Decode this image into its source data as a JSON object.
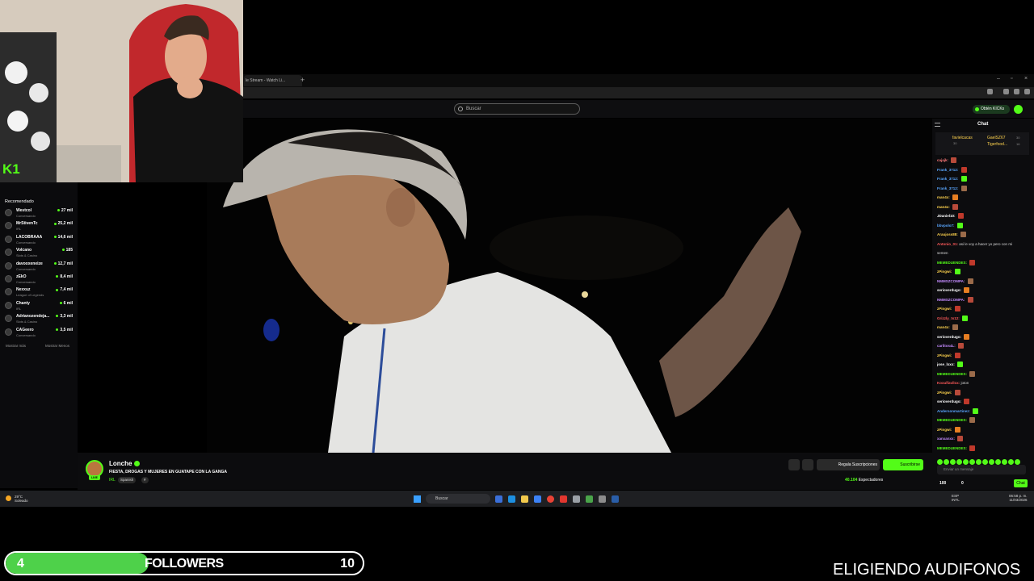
{
  "browser": {
    "tab_title": "le Stream - Watch Li...",
    "new_tab_label": "+",
    "window_controls": [
      "–",
      "▫",
      "×"
    ]
  },
  "header": {
    "search_placeholder": "Buscar",
    "kicks_label": "Obtén KICKs"
  },
  "sidebar": {
    "heading": "Recomendado",
    "items": [
      {
        "name": "Westcol",
        "category": "Conversando",
        "viewers": "27 mil"
      },
      {
        "name": "MrStivenTc",
        "category": "IRL",
        "viewers": "25,2 mil"
      },
      {
        "name": "LACOBRAAA",
        "category": "Conversando",
        "viewers": "14,6 mil"
      },
      {
        "name": "Volcano",
        "category": "Slots & Casino",
        "viewers": "185"
      },
      {
        "name": "davooxeneize",
        "category": "Conversando",
        "viewers": "12,7 mil"
      },
      {
        "name": "zEkO",
        "category": "Conversando",
        "viewers": "8,4 mil"
      },
      {
        "name": "Nexxuz",
        "category": "League of Legends",
        "viewers": "7,4 mil"
      },
      {
        "name": "Chanty",
        "category": "IRL",
        "viewers": "6 mil"
      },
      {
        "name": "Adrianozendeja...",
        "category": "Slots & Casino",
        "viewers": "3,3 mil"
      },
      {
        "name": "CAGeero",
        "category": "Conversando",
        "viewers": "3,5 mil"
      }
    ],
    "show_more": "Mostrar más",
    "show_less": "Mostrar Menos"
  },
  "stream": {
    "streamer": "Lonche",
    "live_badge": "LIVE",
    "title": "FIESTA, DROGAS Y MUJERES EN GUATAPE CON LA GANGA",
    "category": "IRL",
    "tags": [
      "Spanish",
      "#"
    ],
    "gift_label": "Regala Suscripciones",
    "subscribe_label": "Suscribirse",
    "viewer_count": "40.104",
    "viewer_label": "Espectadores"
  },
  "chat": {
    "title": "Chat",
    "pinned": [
      {
        "name": "favielcacas",
        "count": "30"
      },
      {
        "name": "GaelSZ67",
        "count": "30"
      },
      {
        "name": "Tigerfood...",
        "count": "16"
      }
    ],
    "messages": [
      {
        "user": "cajajk:",
        "msg": "",
        "color": "#ff7a7a"
      },
      {
        "user": "Frank_3712:",
        "msg": "",
        "color": "#5aa7ff"
      },
      {
        "user": "Frank_3712:",
        "msg": "",
        "color": "#5aa7ff"
      },
      {
        "user": "Frank_3712:",
        "msg": "",
        "color": "#5aa7ff"
      },
      {
        "user": "man4x:",
        "msg": "",
        "color": "#ffd34d"
      },
      {
        "user": "man4x:",
        "msg": "",
        "color": "#ffd34d"
      },
      {
        "user": "JDaniel10:",
        "msg": "",
        "color": "#ffffff"
      },
      {
        "user": "bbvpolo7:",
        "msg": "",
        "color": "#5aa7ff"
      },
      {
        "user": "Araujoss88:",
        "msg": "",
        "color": "#ffd34d"
      },
      {
        "user": "Antonio_01:",
        "msg": "asi le voy a hacer yo pero con mi",
        "color": "#ff5a5a"
      },
      {
        "user": "",
        "msg": "semen",
        "color": "#ddd"
      },
      {
        "user": "MEMEDUENDES:",
        "msg": "",
        "color": "#53fc18"
      },
      {
        "user": "zPingwi:",
        "msg": "",
        "color": "#ffd34d"
      },
      {
        "user": "NMMSZCOMPA:",
        "msg": "",
        "color": "#c48bff"
      },
      {
        "user": "serioverdugo:",
        "msg": "",
        "color": "#ffffff"
      },
      {
        "user": "NMMSZCOMPA:",
        "msg": "",
        "color": "#c48bff"
      },
      {
        "user": "zPingwi:",
        "msg": "",
        "color": "#ffd34d"
      },
      {
        "user": "Grizzly_ts12:",
        "msg": "",
        "color": "#ff5a5a"
      },
      {
        "user": "man4x:",
        "msg": "",
        "color": "#ffd34d"
      },
      {
        "user": "serioverdugo:",
        "msg": "",
        "color": "#ffffff"
      },
      {
        "user": "carlitos4L:",
        "msg": "",
        "color": "#c48bff"
      },
      {
        "user": "zPingwi:",
        "msg": "",
        "color": "#ffd34d"
      },
      {
        "user": "jose_lxxx:",
        "msg": "",
        "color": "#ffffff"
      },
      {
        "user": "MEMEDUENDES:",
        "msg": "",
        "color": "#53fc18"
      },
      {
        "user": "Koxulfavilox:",
        "msg": "joton",
        "color": "#ff5a5a"
      },
      {
        "user": "zPingwi:",
        "msg": "",
        "color": "#ffd34d"
      },
      {
        "user": "serioverdugo:",
        "msg": "",
        "color": "#ffffff"
      },
      {
        "user": "Andersonmartinez:",
        "msg": "",
        "color": "#5aa7ff"
      },
      {
        "user": "MEMEDUENDES:",
        "msg": "",
        "color": "#53fc18"
      },
      {
        "user": "zPingwi:",
        "msg": "",
        "color": "#ffd34d"
      },
      {
        "user": "xanxanxx:",
        "msg": "",
        "color": "#c48bff"
      },
      {
        "user": "MEMEDUENDES:",
        "msg": "",
        "color": "#53fc18"
      }
    ],
    "input_placeholder": "Enviar un mensaje",
    "points_a": "100",
    "points_b": "0",
    "send_label": "Chat"
  },
  "taskbar": {
    "weather_temp": "29°C",
    "weather_desc": "Soleado",
    "search_label": "Buscar",
    "tray_lang": "ESP",
    "tray_layout": "INTL",
    "time": "06:58 p. m.",
    "date": "11/03/2026"
  },
  "overlay": {
    "cam_logo": "K1",
    "goal_current": "4",
    "goal_label": "FOLLOWERS",
    "goal_target": "10",
    "goal_progress": 0.4,
    "bottom_text": "ELIGIENDO AUDIFONOS"
  }
}
